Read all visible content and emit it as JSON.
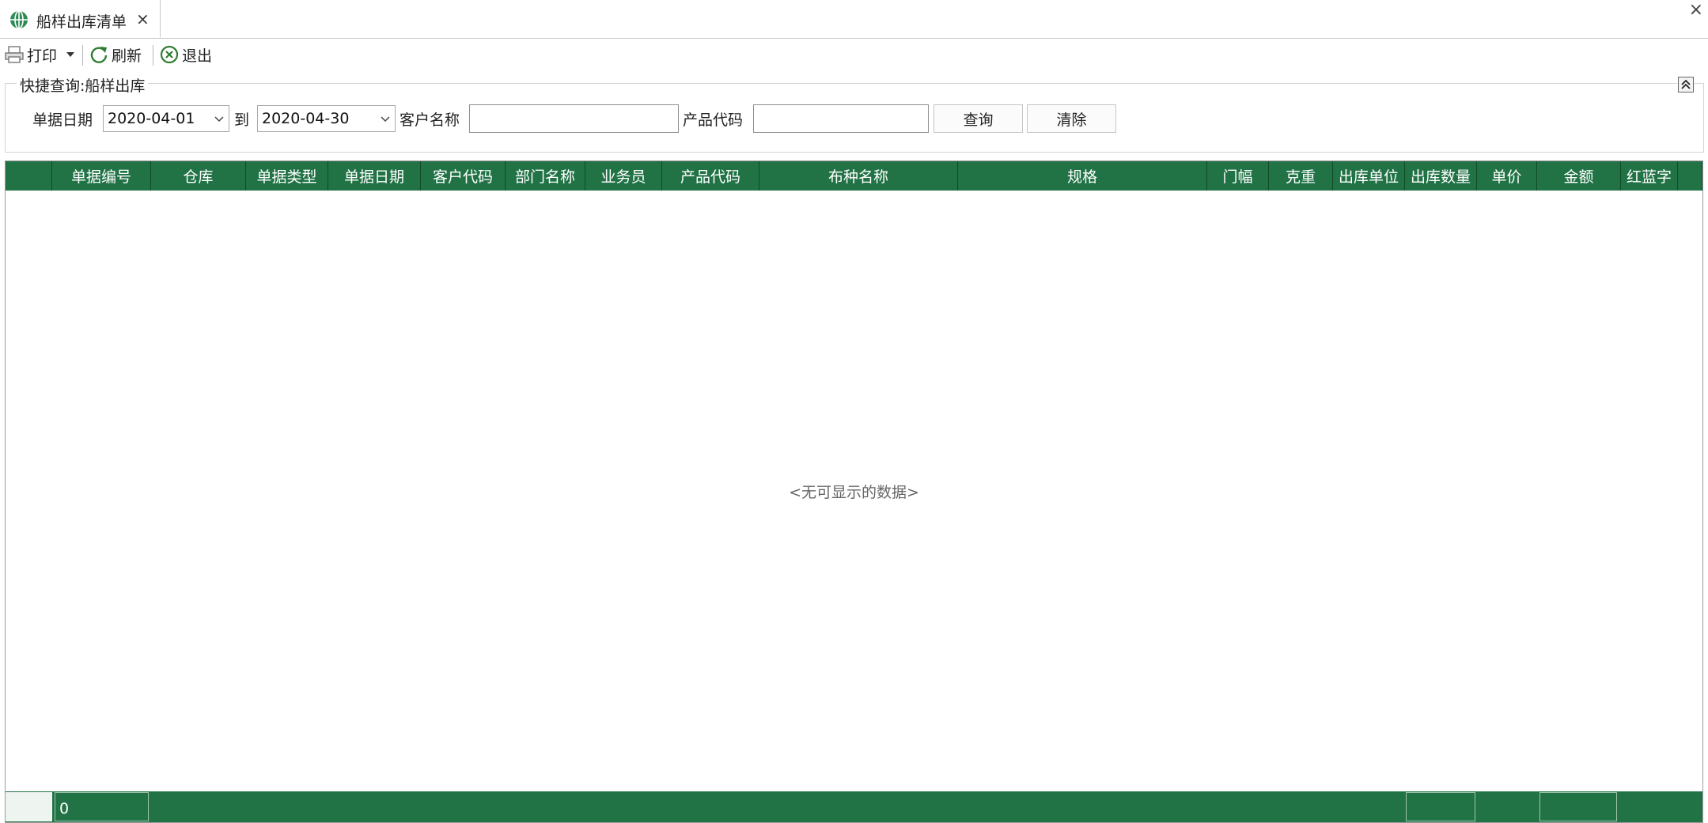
{
  "tab": {
    "title": "船样出库清单",
    "close": "×"
  },
  "window": {
    "close": "×"
  },
  "toolbar": {
    "print_label": "打印",
    "refresh_label": "刷新",
    "exit_label": "退出"
  },
  "query": {
    "group_title": "快捷查询:船样出库",
    "date_label": "单据日期",
    "date_from": "2020-04-01",
    "to_label": "到",
    "date_to": "2020-04-30",
    "customer_label": "客户名称",
    "customer_value": "",
    "product_label": "产品代码",
    "product_value": "",
    "search_button": "查询",
    "clear_button": "清除"
  },
  "grid": {
    "columns": [
      "单据编号",
      "仓库",
      "单据类型",
      "单据日期",
      "客户代码",
      "部门名称",
      "业务员",
      "产品代码",
      "布种名称",
      "规格",
      "门幅",
      "克重",
      "出库单位",
      "出库数量",
      "单价",
      "金额",
      "红蓝字"
    ],
    "empty_text": "<无可显示的数据>",
    "footer_count": "0"
  },
  "colors": {
    "header_bg": "#217346",
    "header_text": "#ffffff"
  }
}
